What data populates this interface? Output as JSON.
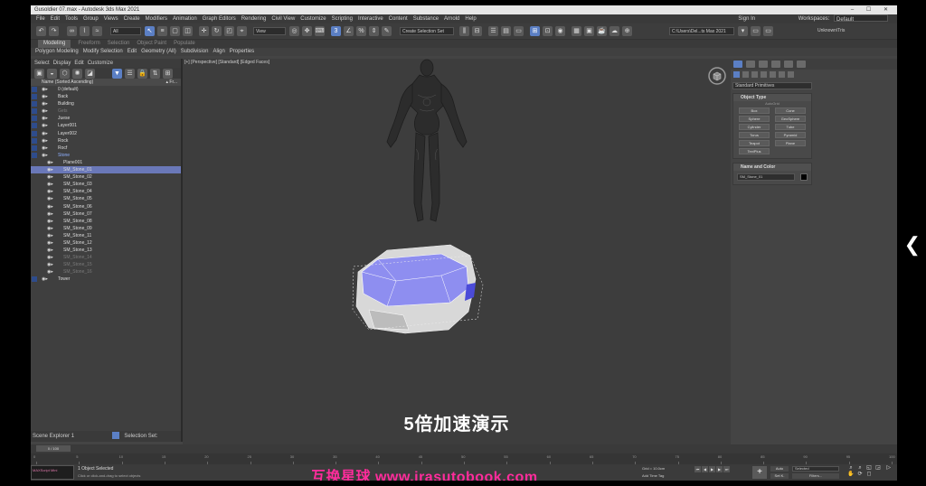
{
  "window": {
    "title": "Gusoldier 07.max - Autodesk 3ds Max 2021"
  },
  "menubar": {
    "items": [
      "File",
      "Edit",
      "Tools",
      "Group",
      "Views",
      "Create",
      "Modifiers",
      "Animation",
      "Graph Editors",
      "Rendering",
      "Civil View",
      "Customize",
      "Scripting",
      "Interactive",
      "Content",
      "Substance",
      "Arnold",
      "Help"
    ],
    "user": "Sign In",
    "workspaces_label": "Workspaces:",
    "workspace": "Default"
  },
  "toolbar": {
    "filter": "All",
    "refcoord": "View",
    "selset": "Create Selection Set",
    "path": "C:\\Users\\Del...ts Max 2021",
    "user": "Unknown\\Tris"
  },
  "ribbon": {
    "tabs": [
      "Modeling",
      "Freeform",
      "Selection",
      "Object Paint",
      "Populate"
    ],
    "active": 0
  },
  "ribbon2": {
    "items": [
      "Polygon Modeling",
      "Modify Selection",
      "Edit",
      "Geometry (All)",
      "Subdivision",
      "Align",
      "Properties"
    ]
  },
  "explorer": {
    "menu": [
      "Select",
      "Display",
      "Edit",
      "Customize"
    ],
    "header": "Name (Sorted Ascending)",
    "header_right": "▴ Fr...",
    "rows": [
      {
        "label": "0 (default)",
        "indent": 0,
        "state": "normal"
      },
      {
        "label": "Back",
        "indent": 0,
        "state": "normal"
      },
      {
        "label": "Building",
        "indent": 0,
        "state": "normal"
      },
      {
        "label": "Gets",
        "indent": 0,
        "state": "dim"
      },
      {
        "label": "Juese",
        "indent": 0,
        "state": "normal"
      },
      {
        "label": "Layer001",
        "indent": 0,
        "state": "normal"
      },
      {
        "label": "Layer002",
        "indent": 0,
        "state": "normal"
      },
      {
        "label": "Rock",
        "indent": 0,
        "state": "normal"
      },
      {
        "label": "Rocf",
        "indent": 0,
        "state": "normal"
      },
      {
        "label": "Stone",
        "indent": 0,
        "state": "hl"
      },
      {
        "label": "Plane001",
        "indent": 1,
        "state": "normal"
      },
      {
        "label": "SM_Stone_01",
        "indent": 1,
        "state": "sel"
      },
      {
        "label": "SM_Stone_02",
        "indent": 1,
        "state": "normal"
      },
      {
        "label": "SM_Stone_03",
        "indent": 1,
        "state": "normal"
      },
      {
        "label": "SM_Stone_04",
        "indent": 1,
        "state": "normal"
      },
      {
        "label": "SM_Stone_05",
        "indent": 1,
        "state": "normal"
      },
      {
        "label": "SM_Stone_06",
        "indent": 1,
        "state": "normal"
      },
      {
        "label": "SM_Stone_07",
        "indent": 1,
        "state": "normal"
      },
      {
        "label": "SM_Stone_08",
        "indent": 1,
        "state": "normal"
      },
      {
        "label": "SM_Stone_09",
        "indent": 1,
        "state": "normal"
      },
      {
        "label": "SM_Stone_11",
        "indent": 1,
        "state": "normal"
      },
      {
        "label": "SM_Stone_12",
        "indent": 1,
        "state": "normal"
      },
      {
        "label": "SM_Stone_13",
        "indent": 1,
        "state": "normal"
      },
      {
        "label": "SM_Stone_14",
        "indent": 1,
        "state": "dim"
      },
      {
        "label": "SM_Stone_15",
        "indent": 1,
        "state": "dim"
      },
      {
        "label": "SM_Stone_16",
        "indent": 1,
        "state": "dim"
      },
      {
        "label": "Tower",
        "indent": 0,
        "state": "normal"
      }
    ],
    "footer_name": "Scene Explorer 1",
    "footer_selset": "Selection Set:"
  },
  "viewport": {
    "label": "[+] [Perspective] [Standard] [Edged Faces]"
  },
  "subtitle": "5倍加速演示",
  "command_panel": {
    "category": "Standard Primitives",
    "object_type_title": "Object Type",
    "autogrid": "AutoGrid",
    "buttons": [
      "Box",
      "Cone",
      "Sphere",
      "GeoSphere",
      "Cylinder",
      "Tube",
      "Torus",
      "Pyramid",
      "Teapot",
      "Plane",
      "TextPlus"
    ],
    "name_color_title": "Name and Color",
    "object_name": "SM_Stone_01"
  },
  "timeline": {
    "slider": "0 / 100",
    "ticks": [
      "0",
      "5",
      "10",
      "15",
      "20",
      "25",
      "30",
      "35",
      "40",
      "45",
      "50",
      "55",
      "60",
      "65",
      "70",
      "75",
      "80",
      "85",
      "90",
      "95",
      "100"
    ]
  },
  "status": {
    "maxscript": "MAXScript Mini",
    "line1": "1 Object Selected",
    "line2": "Click or click-and-drag to select objects",
    "grid": "Grid = 10.0cm",
    "addtime": "Add Time Tag",
    "autokey": "Auto",
    "setkey": "Set K.",
    "selected": "Selected",
    "filters": "Filters..."
  },
  "watermark": "互换星球 www.irasutobook.com",
  "colors": {
    "selection": "#6a78b8",
    "accent": "#5b7fc4",
    "watermark": "#ff2c9c"
  }
}
